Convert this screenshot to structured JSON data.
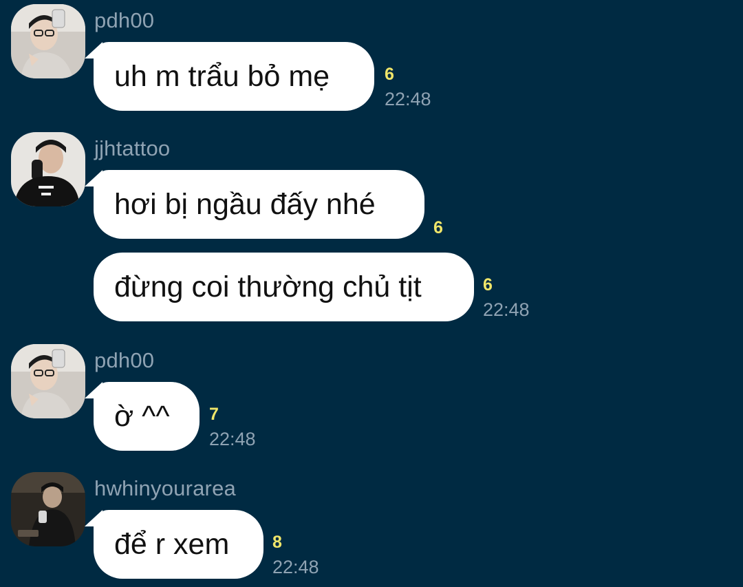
{
  "messages": [
    {
      "sender": "pdh00",
      "avatar": "avatar-pdh00",
      "bubbles": [
        {
          "text": "uh m trẩu bỏ mẹ",
          "unread": "6",
          "time": "22:48"
        }
      ]
    },
    {
      "sender": "jjhtattoo",
      "avatar": "avatar-jjhtattoo",
      "bubbles": [
        {
          "text": "hơi bị ngầu đấy nhé",
          "unread": "6",
          "time": ""
        },
        {
          "text": "đừng coi thường chủ tịt",
          "unread": "6",
          "time": "22:48"
        }
      ]
    },
    {
      "sender": "pdh00",
      "avatar": "avatar-pdh00",
      "bubbles": [
        {
          "text": "ờ ^^",
          "unread": "7",
          "time": "22:48"
        }
      ]
    },
    {
      "sender": "hwhinyourarea",
      "avatar": "avatar-hwhinyourarea",
      "bubbles": [
        {
          "text": "để r xem",
          "unread": "8",
          "time": "22:48"
        }
      ]
    }
  ],
  "colors": {
    "background": "#002a42",
    "bubble": "#ffffff",
    "unread": "#f0e66a",
    "meta_text": "#8fa3b3"
  }
}
